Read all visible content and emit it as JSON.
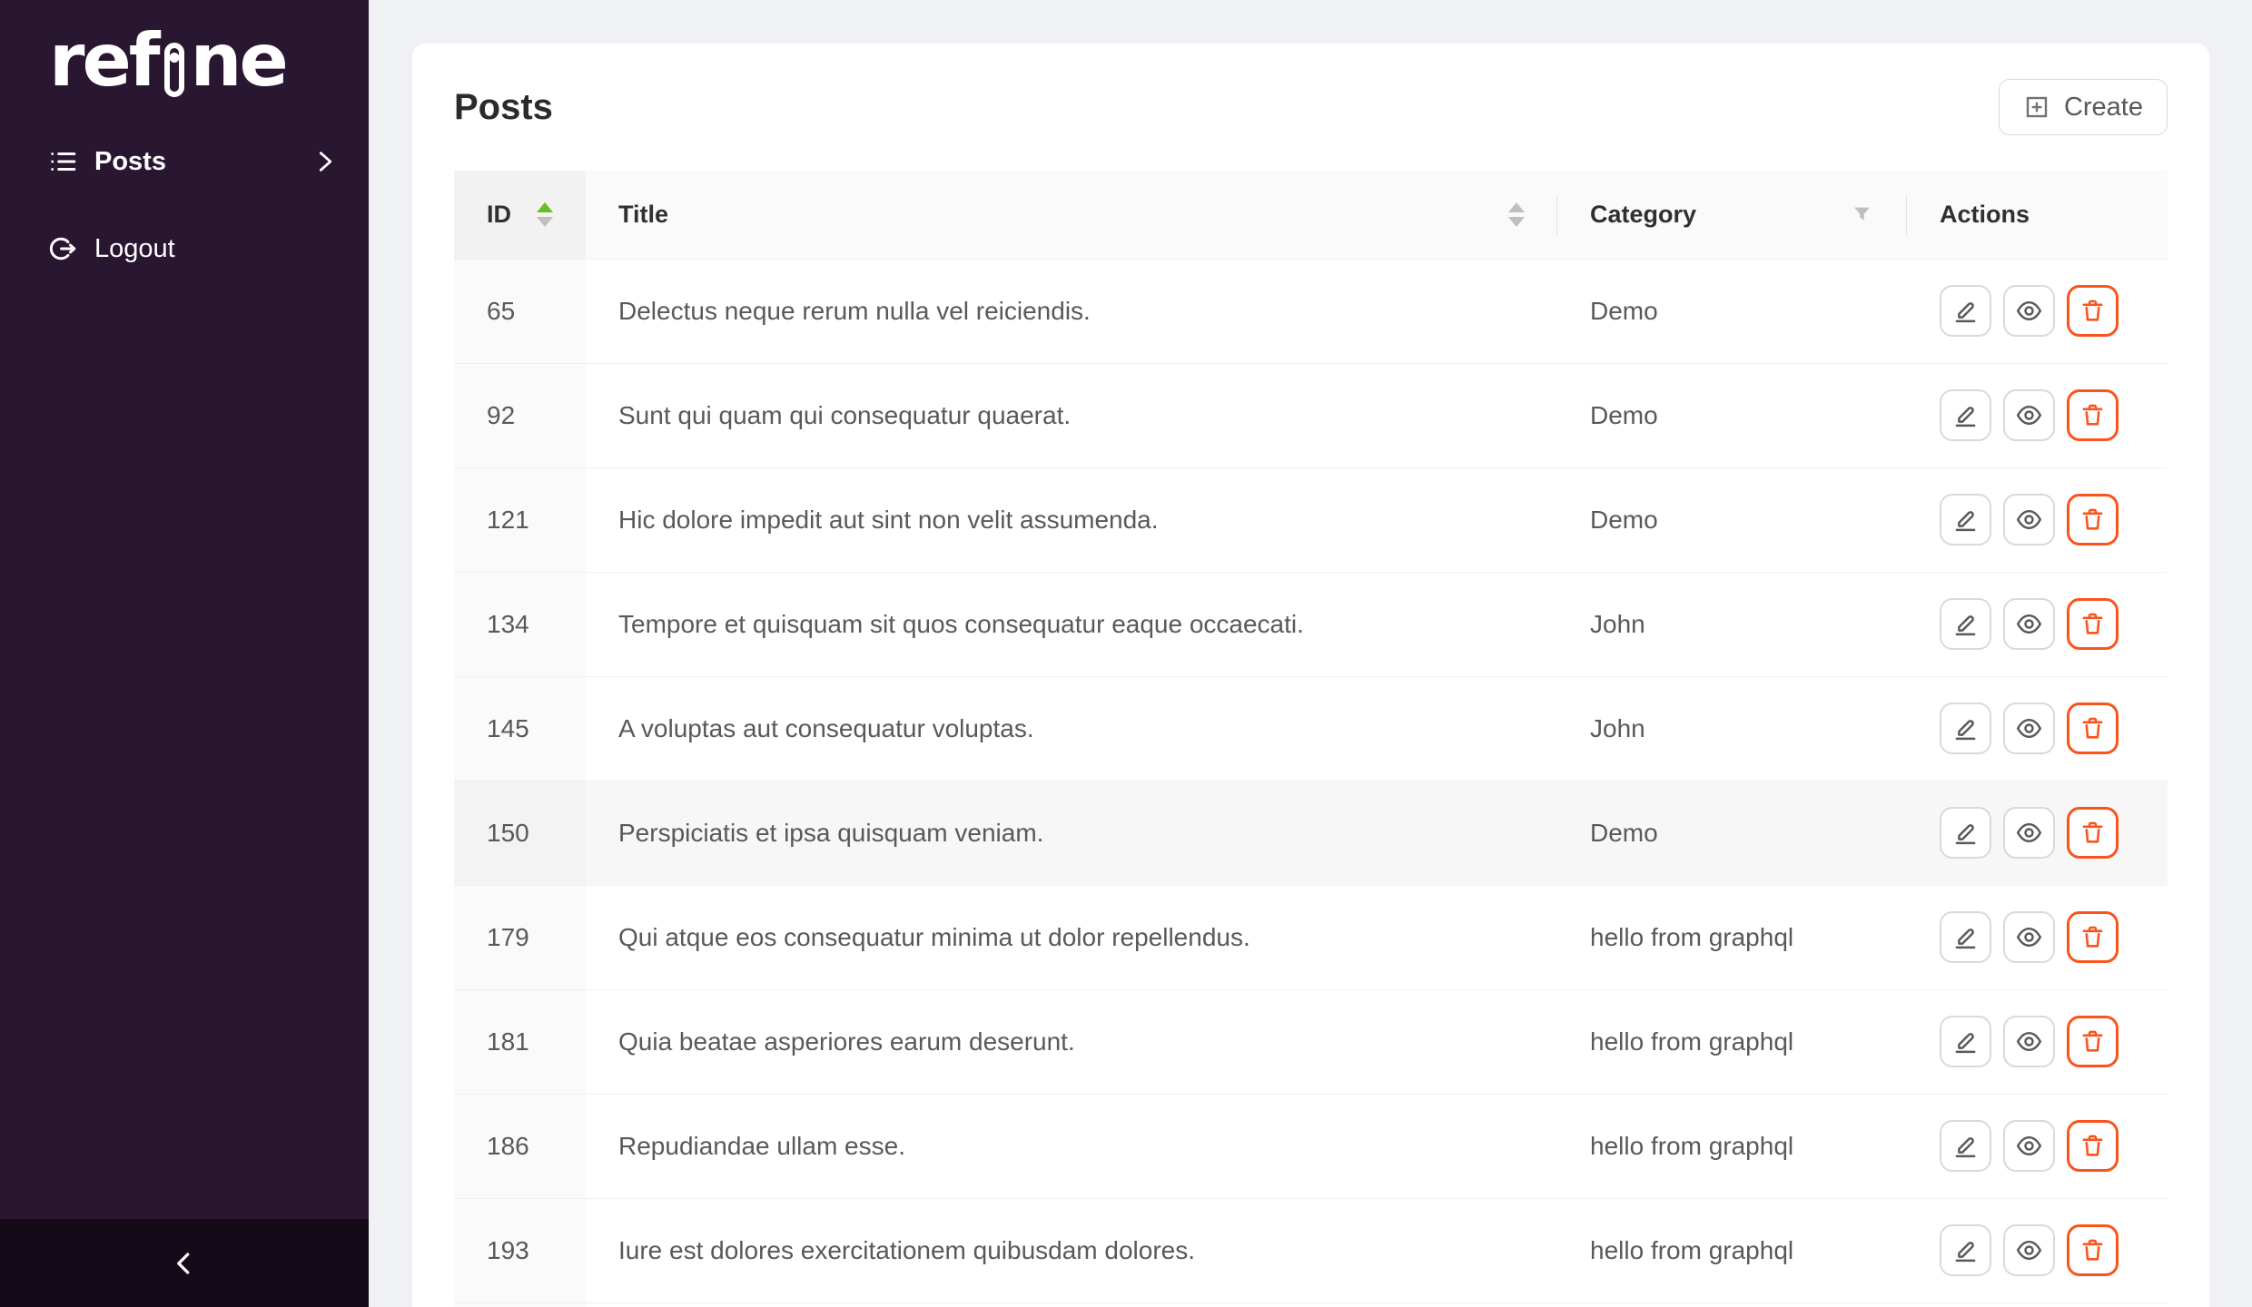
{
  "colors": {
    "sidebar_bg": "#291630",
    "sidebar_trigger_bg": "#140a18",
    "accent_green": "#67be23",
    "danger_orange": "#fa541c",
    "page_bg": "#f0f1f5"
  },
  "sidebar": {
    "logo_text_left": "ref",
    "logo_text_right": "ne",
    "items": [
      {
        "label": "Posts",
        "icon": "unordered-list-icon",
        "active": true
      }
    ],
    "logout_label": "Logout",
    "collapse_icon": "chevron-left-icon"
  },
  "header": {
    "title": "Posts",
    "create_label": "Create",
    "create_icon": "plus-square-icon"
  },
  "table": {
    "columns": [
      {
        "key": "id",
        "label": "ID",
        "sortable": true,
        "sort_state": "ascending"
      },
      {
        "key": "title",
        "label": "Title",
        "sortable": true,
        "sort_state": "none"
      },
      {
        "key": "category",
        "label": "Category",
        "filterable": true
      },
      {
        "key": "actions",
        "label": "Actions"
      }
    ],
    "row_action_icons": [
      "edit-icon",
      "eye-icon",
      "trash-icon"
    ],
    "rows": [
      {
        "id": "65",
        "title": "Delectus neque rerum nulla vel reiciendis.",
        "category": "Demo"
      },
      {
        "id": "92",
        "title": "Sunt qui quam qui consequatur quaerat.",
        "category": "Demo"
      },
      {
        "id": "121",
        "title": "Hic dolore impedit aut sint non velit assumenda.",
        "category": "Demo"
      },
      {
        "id": "134",
        "title": "Tempore et quisquam sit quos consequatur eaque occaecati.",
        "category": "John"
      },
      {
        "id": "145",
        "title": "A voluptas aut consequatur voluptas.",
        "category": "John"
      },
      {
        "id": "150",
        "title": "Perspiciatis et ipsa quisquam veniam.",
        "category": "Demo",
        "highlighted": true
      },
      {
        "id": "179",
        "title": "Qui atque eos consequatur minima ut dolor repellendus.",
        "category": "hello from graphql"
      },
      {
        "id": "181",
        "title": "Quia beatae asperiores earum deserunt.",
        "category": "hello from graphql"
      },
      {
        "id": "186",
        "title": "Repudiandae ullam esse.",
        "category": "hello from graphql"
      },
      {
        "id": "193",
        "title": "Iure est dolores exercitationem quibusdam dolores.",
        "category": "hello from graphql"
      }
    ]
  }
}
